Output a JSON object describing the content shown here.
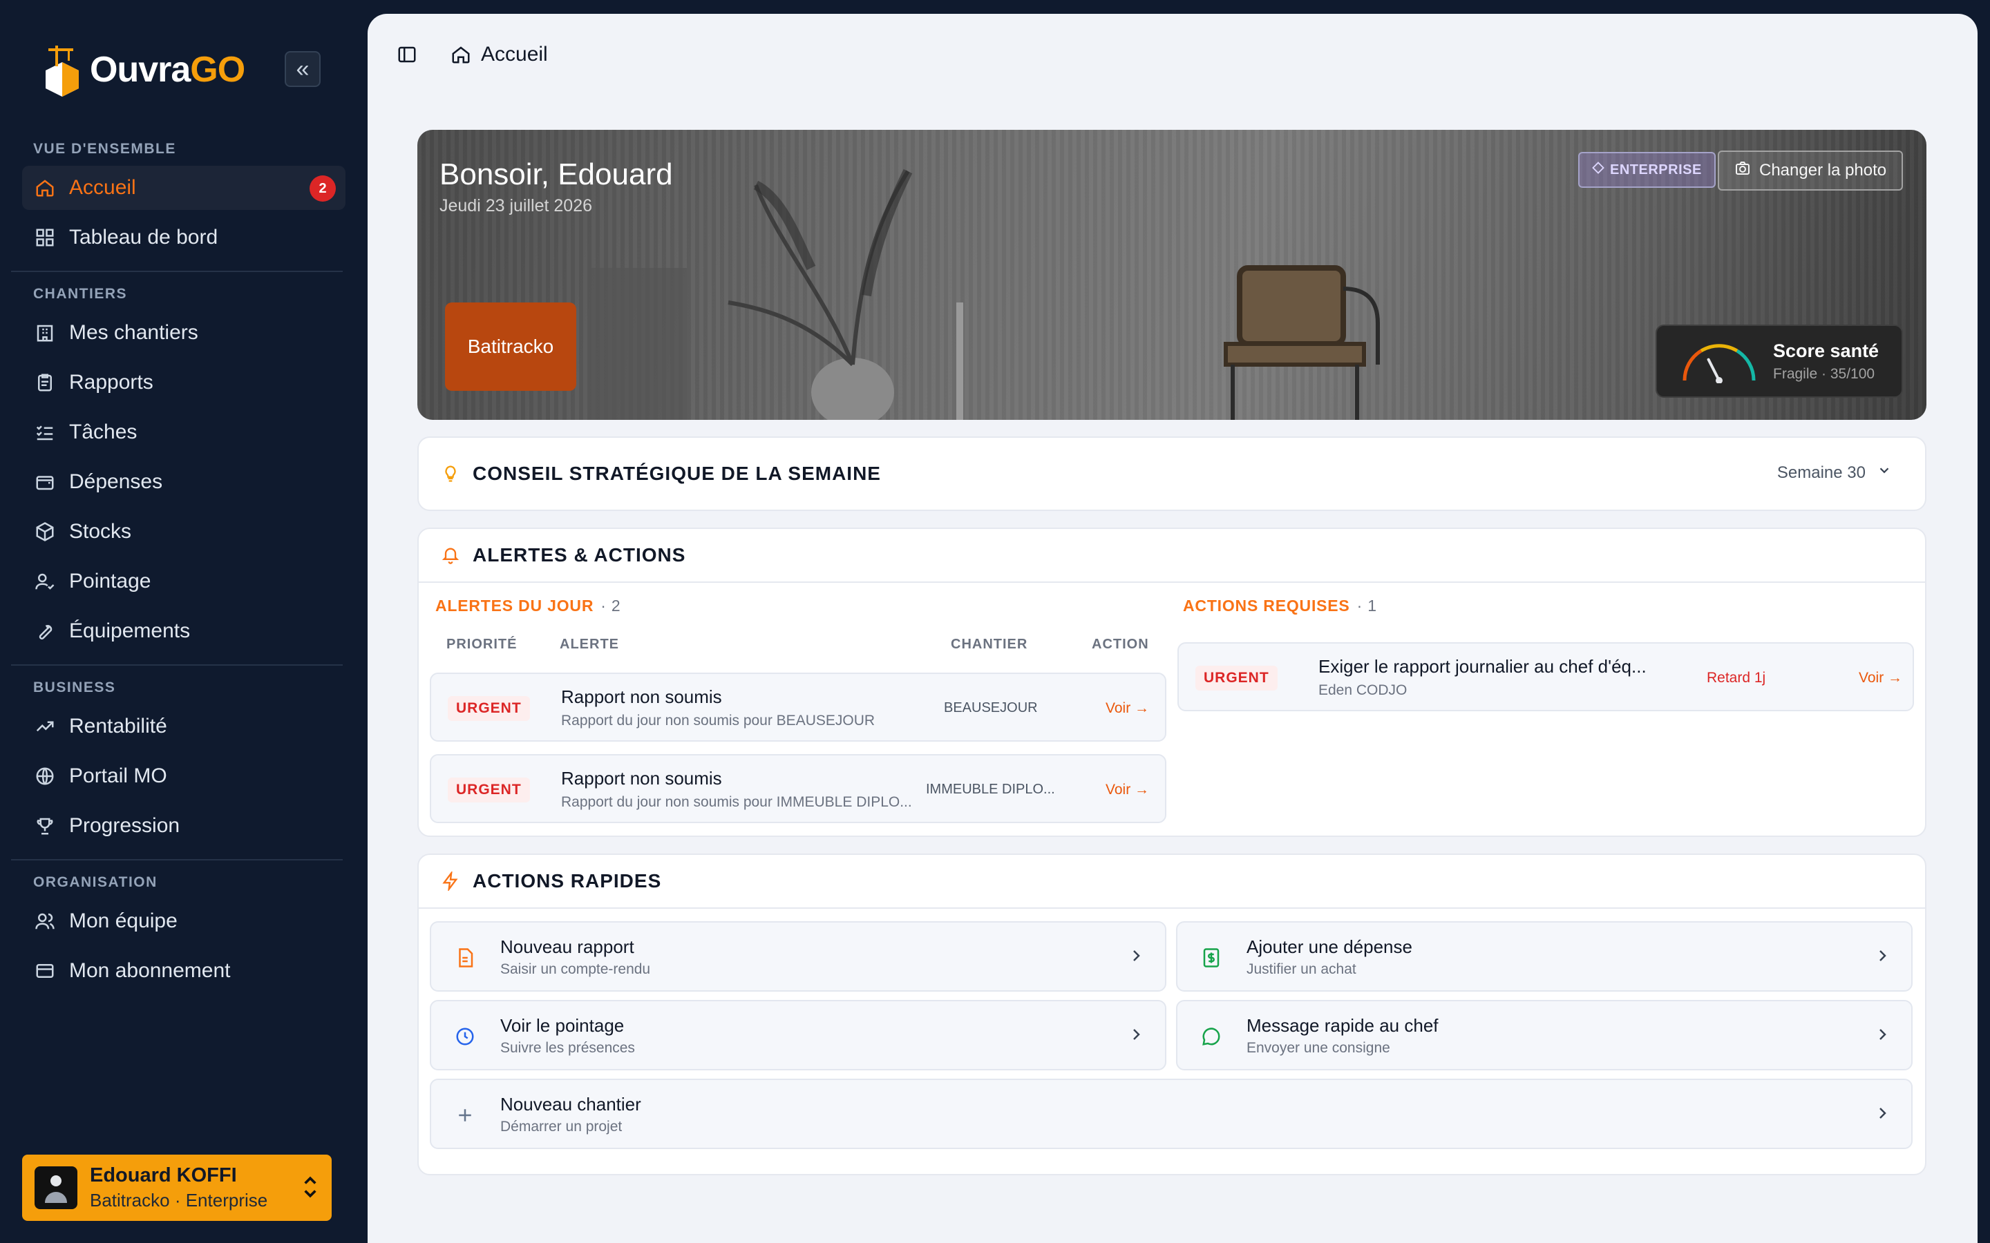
{
  "brand": {
    "name_main": "Ouvra",
    "name_accent": "GO"
  },
  "sidebar": {
    "sections": [
      {
        "title": "VUE D'ENSEMBLE",
        "items": [
          {
            "label": "Accueil",
            "badge": "2",
            "active": true
          },
          {
            "label": "Tableau de bord"
          }
        ]
      },
      {
        "title": "CHANTIERS",
        "items": [
          {
            "label": "Mes chantiers"
          },
          {
            "label": "Rapports"
          },
          {
            "label": "Tâches"
          },
          {
            "label": "Dépenses"
          },
          {
            "label": "Stocks"
          },
          {
            "label": "Pointage"
          },
          {
            "label": "Équipements"
          }
        ]
      },
      {
        "title": "BUSINESS",
        "items": [
          {
            "label": "Rentabilité"
          },
          {
            "label": "Portail MO"
          },
          {
            "label": "Progression"
          }
        ]
      },
      {
        "title": "ORGANISATION",
        "items": [
          {
            "label": "Mon équipe"
          },
          {
            "label": "Mon abonnement"
          }
        ]
      }
    ],
    "user": {
      "name": "Edouard KOFFI",
      "subtitle": "Batitracko · Enterprise"
    }
  },
  "topbar": {
    "breadcrumb": "Accueil"
  },
  "hero": {
    "greeting": "Bonsoir, Edouard",
    "date": "Jeudi 23 juillet 2026",
    "company": "Batitracko",
    "plan_badge": "ENTERPRISE",
    "change_photo": "Changer la photo",
    "score": {
      "title": "Score santé",
      "subtitle": "Fragile · 35/100",
      "value": 35,
      "max": 100
    }
  },
  "advice": {
    "title": "CONSEIL STRATÉGIQUE DE LA SEMAINE",
    "week": "Semaine 30"
  },
  "alerts": {
    "title": "ALERTES & ACTIONS",
    "today": {
      "title": "ALERTES DU JOUR",
      "count": "· 2",
      "columns": [
        "PRIORITÉ",
        "ALERTE",
        "CHANTIER",
        "ACTION"
      ],
      "rows": [
        {
          "priority": "URGENT",
          "title": "Rapport non soumis",
          "sub": "Rapport du jour non soumis pour BEAUSEJOUR",
          "chantier": "BEAUSEJOUR",
          "action": "Voir →"
        },
        {
          "priority": "URGENT",
          "title": "Rapport non soumis",
          "sub": "Rapport du jour non soumis pour IMMEUBLE DIPLO...",
          "chantier": "IMMEUBLE DIPLO...",
          "action": "Voir →"
        }
      ]
    },
    "required": {
      "title": "ACTIONS REQUISES",
      "count": "· 1",
      "rows": [
        {
          "priority": "URGENT",
          "title": "Exiger le rapport journalier au chef d'éq...",
          "sub": "Eden CODJO",
          "delay": "Retard 1j",
          "action": "Voir →"
        }
      ]
    }
  },
  "quick": {
    "title": "ACTIONS RAPIDES",
    "items": [
      {
        "title": "Nouveau rapport",
        "sub": "Saisir un compte-rendu",
        "icon": "document-icon",
        "color": "#f97316"
      },
      {
        "title": "Ajouter une dépense",
        "sub": "Justifier un achat",
        "icon": "money-icon",
        "color": "#16a34a"
      },
      {
        "title": "Voir le pointage",
        "sub": "Suivre les présences",
        "icon": "clock-icon",
        "color": "#2563eb"
      },
      {
        "title": "Message rapide au chef",
        "sub": "Envoyer une consigne",
        "icon": "chat-icon",
        "color": "#16a34a"
      },
      {
        "title": "Nouveau chantier",
        "sub": "Démarrer un projet",
        "icon": "plus-icon",
        "color": "#64748b"
      }
    ]
  },
  "colors": {
    "accent": "#f97316",
    "sidebar_bg": "#0f1a2e",
    "danger": "#dc2626",
    "company": "#b8470f"
  }
}
